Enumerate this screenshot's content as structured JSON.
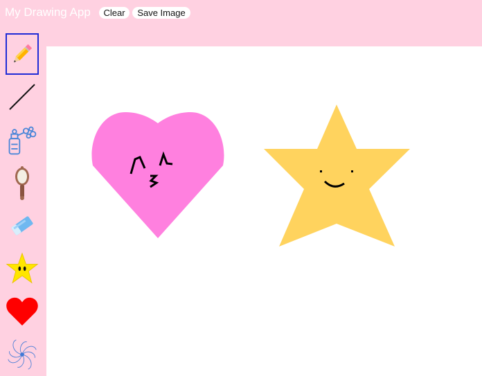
{
  "app": {
    "title": "My Drawing App"
  },
  "buttons": {
    "clear_label": "Clear",
    "save_label": "Save Image"
  },
  "toolbar": {
    "selected": "pencil",
    "tools": [
      {
        "id": "pencil",
        "icon": "pencil-icon"
      },
      {
        "id": "line",
        "icon": "line-icon"
      },
      {
        "id": "spray",
        "icon": "spray-bottle-icon"
      },
      {
        "id": "mirror",
        "icon": "hand-mirror-icon"
      },
      {
        "id": "eraser",
        "icon": "eraser-icon"
      },
      {
        "id": "star",
        "icon": "star-icon"
      },
      {
        "id": "heart",
        "icon": "heart-icon"
      },
      {
        "id": "spiral",
        "icon": "spiral-icon"
      }
    ]
  },
  "canvas": {
    "shapes": [
      {
        "type": "heart",
        "color": "#ff80df",
        "face": "kissing-face"
      },
      {
        "type": "star",
        "color": "#ffd35e",
        "face": "smile-face"
      }
    ]
  },
  "colors": {
    "background": "#ffd1e1",
    "selected_border": "#1f2bd6",
    "canvas": "#ffffff"
  }
}
